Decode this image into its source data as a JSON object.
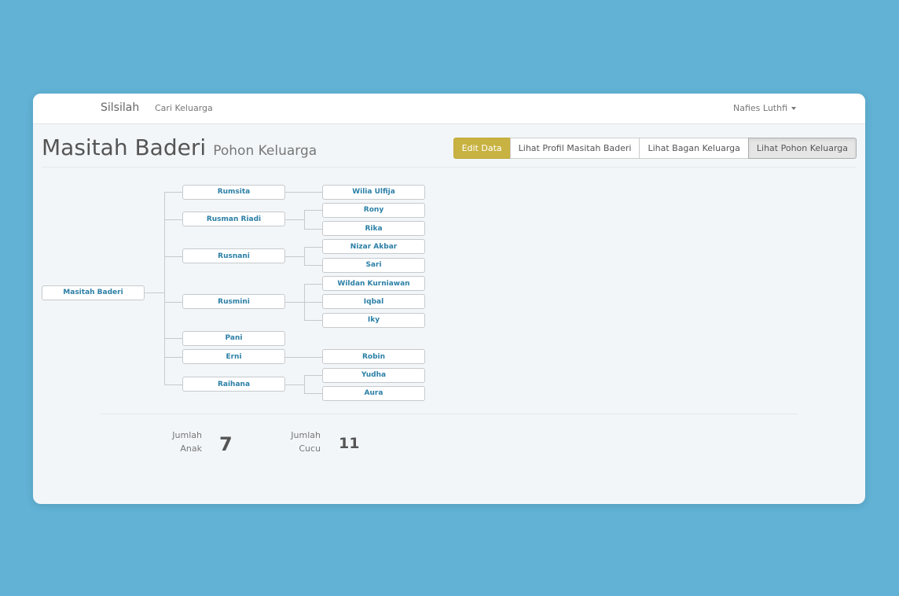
{
  "navbar": {
    "brand": "Silsilah",
    "links": [
      "Cari Keluarga"
    ],
    "user": "Nafies Luthfi"
  },
  "page": {
    "title": "Masitah Baderi",
    "subtitle": "Pohon Keluarga"
  },
  "actions": {
    "edit": "Edit Data",
    "profile": "Lihat Profil Masitah Baderi",
    "chart": "Lihat Bagan Keluarga",
    "tree": "Lihat Pohon Keluarga"
  },
  "tree": {
    "root": "Masitah Baderi",
    "children": [
      {
        "name": "Rumsita",
        "children": [
          "Wilia Ulfija"
        ]
      },
      {
        "name": "Rusman Riadi",
        "children": [
          "Rony",
          "Rika"
        ]
      },
      {
        "name": "Rusnani",
        "children": [
          "Nizar Akbar",
          "Sari"
        ]
      },
      {
        "name": "Rusmini",
        "children": [
          "Wildan Kurniawan",
          "Iqbal",
          "Iky"
        ]
      },
      {
        "name": "Pani",
        "children": []
      },
      {
        "name": "Erni",
        "children": [
          "Robin"
        ]
      },
      {
        "name": "Raihana",
        "children": [
          "Yudha",
          "Aura"
        ]
      }
    ]
  },
  "stats": {
    "children_label_1": "Jumlah",
    "children_label_2": "Anak",
    "children_count": "7",
    "grandchildren_label_1": "Jumlah",
    "grandchildren_label_2": "Cucu",
    "grandchildren_count": "11"
  }
}
